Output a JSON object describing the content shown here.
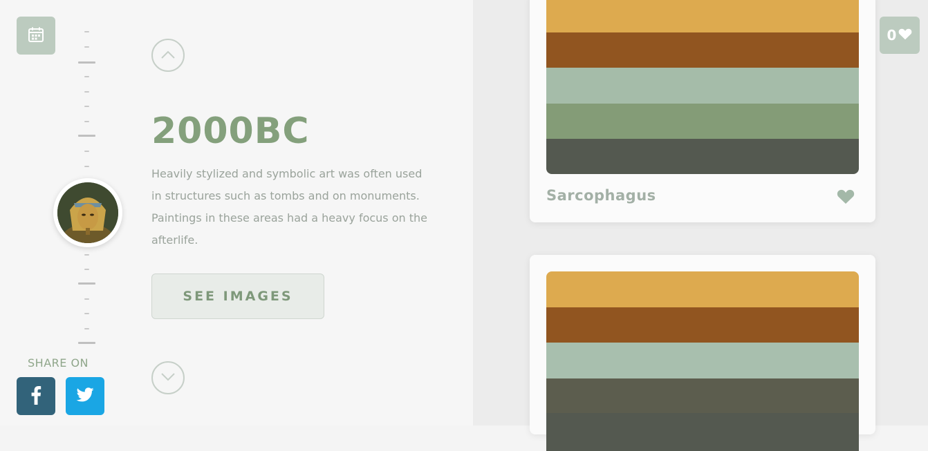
{
  "era": {
    "title": "2000BC",
    "description": "Heavily stylized and symbolic art was often used in structures such as tombs and on monuments. Paintings in these areas had a heavy focus on the afterlife.",
    "see_images_label": "SEE IMAGES"
  },
  "share": {
    "label": "SHARE ON"
  },
  "likes": {
    "count": "0"
  },
  "icons": {
    "calendar": "calendar-icon",
    "up": "chevron-up-icon",
    "down": "chevron-down-icon",
    "heart": "heart-icon",
    "facebook": "facebook-icon",
    "twitter": "twitter-icon"
  },
  "colors": {
    "accent": "#84a07c",
    "muted_green": "#bccbbf",
    "facebook": "#32637a",
    "twitter": "#1aa6e4"
  },
  "palettes": [
    {
      "name": "Sarcophagus",
      "swatches": [
        "#ddaa4f",
        "#915520",
        "#a5bca9",
        "#849c77",
        "#545950"
      ]
    },
    {
      "name": "",
      "swatches": [
        "#ddaa4f",
        "#915520",
        "#a8bfae",
        "#5c5d4e",
        "#545950"
      ]
    }
  ]
}
